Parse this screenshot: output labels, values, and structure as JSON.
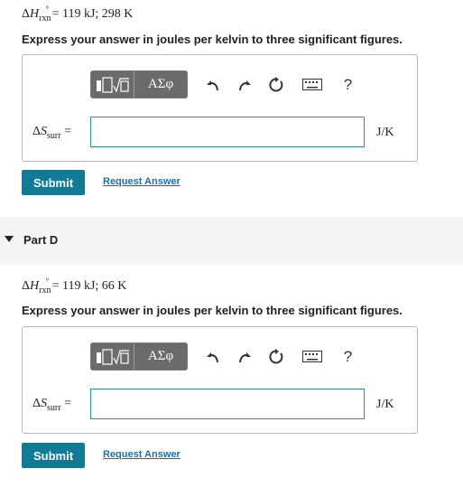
{
  "partC": {
    "given_value": " = 119 kJ; 298 K",
    "instruction": "Express your answer in joules per kelvin to three significant figures.",
    "unit": "J/K",
    "submit_label": "Submit",
    "request_label": "Request Answer"
  },
  "partD": {
    "title": "Part D",
    "given_value": " = 119 kJ; 66 K",
    "instruction": "Express your answer in joules per kelvin to three significant figures.",
    "unit": "J/K",
    "submit_label": "Submit",
    "request_label": "Request Answer"
  },
  "symbols": {
    "delta": "Δ",
    "H": "H",
    "rxn": "rxn",
    "degree": "°",
    "S": "S",
    "surr": "surr",
    "equals": " ="
  },
  "toolbar": {
    "greek_label": "ΑΣφ",
    "help_label": "?"
  },
  "icons": [
    "templates-icon",
    "greek-icon",
    "undo-icon",
    "redo-icon",
    "reset-icon",
    "keyboard-icon",
    "help-icon"
  ],
  "colors": {
    "submit": "#117b96",
    "link": "#1b6fa8",
    "input_border": "#2e8b9a",
    "toolbar": "#6b6b6b"
  }
}
